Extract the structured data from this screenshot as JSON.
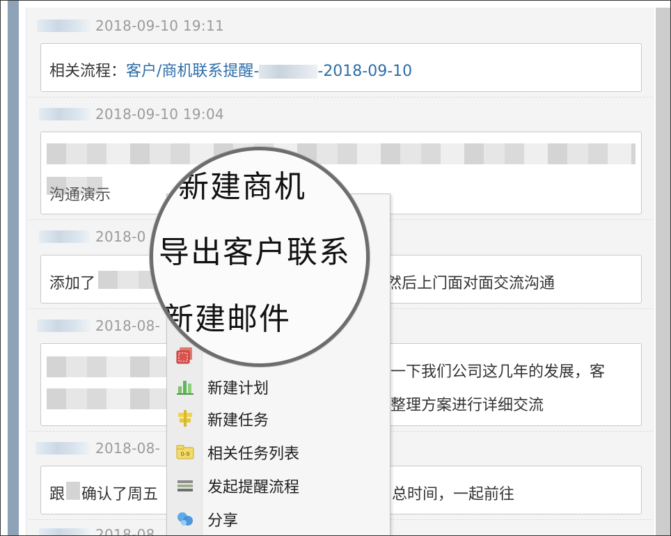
{
  "entries": [
    {
      "timestamp": "2018-09-10 19:11",
      "prefix": "相关流程：",
      "link_prefix": "客户/商机联系提醒-",
      "link_suffix": "-2018-09-10"
    },
    {
      "timestamp": "2018-09-10 19:04",
      "line2_tail": "沟通演示"
    },
    {
      "timestamp_partial": "2018-0",
      "text_start": "添加了",
      "text_end": "然后上门面对面交流沟通"
    },
    {
      "timestamp_partial": "2018-08-",
      "line1_tail": "了一下我们公司这几年的发展，客",
      "line2_tail": "门整理方案进行详细交流"
    },
    {
      "timestamp_partial": "2018-08-",
      "text_start": "跟",
      "text_mid": "确认了周五",
      "text_end": "总时间，一起前往"
    },
    {
      "timestamp_partial": "2018-08"
    }
  ],
  "magnifier": {
    "items": [
      "新建商机",
      "导出客户联系",
      "新建邮件"
    ]
  },
  "context_menu": {
    "items": [
      {
        "label": "",
        "icon": "contact-card-icon",
        "color": "#d9534f"
      },
      {
        "label": "新建计划",
        "icon": "bar-chart-icon",
        "color": "#5cb85c"
      },
      {
        "label": "新建任务",
        "icon": "task-icon",
        "color": "#e6c93a"
      },
      {
        "label": "相关任务列表",
        "icon": "task-list-icon",
        "color": "#e6c93a"
      },
      {
        "label": "发起提醒流程",
        "icon": "reminder-flow-icon",
        "color": "#777777"
      },
      {
        "label": "分享",
        "icon": "share-icon",
        "color": "#3a8fd8"
      }
    ]
  },
  "colors": {
    "link": "#2c6da8",
    "side_bar": "#8ea2b8",
    "timestamp": "#9b9b9b"
  }
}
